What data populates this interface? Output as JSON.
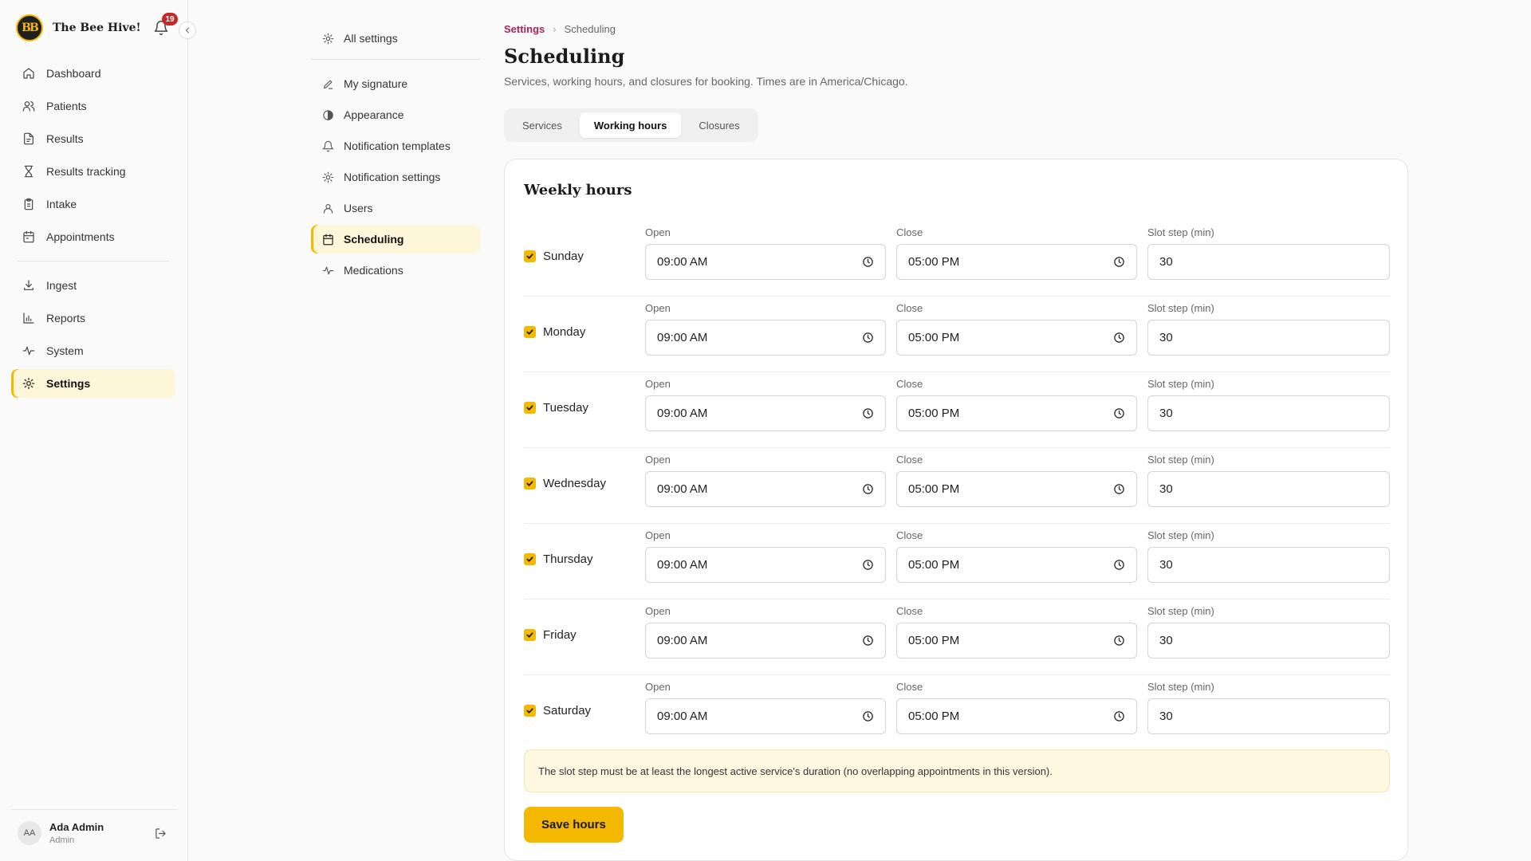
{
  "app": {
    "name": "The Bee Hive!",
    "logo_text": "BB",
    "notification_count": "19"
  },
  "sidebar": {
    "primary": [
      {
        "label": "Dashboard",
        "icon": "home-icon"
      },
      {
        "label": "Patients",
        "icon": "users-icon"
      },
      {
        "label": "Results",
        "icon": "file-icon"
      },
      {
        "label": "Results tracking",
        "icon": "hourglass-icon"
      },
      {
        "label": "Intake",
        "icon": "clipboard-icon"
      },
      {
        "label": "Appointments",
        "icon": "calendar-icon"
      }
    ],
    "secondary": [
      {
        "label": "Ingest",
        "icon": "download-icon"
      },
      {
        "label": "Reports",
        "icon": "bar-chart-icon"
      },
      {
        "label": "System",
        "icon": "activity-icon"
      },
      {
        "label": "Settings",
        "icon": "gear-icon",
        "active": true
      }
    ],
    "user": {
      "initials": "AA",
      "name": "Ada Admin",
      "role": "Admin"
    }
  },
  "settings_nav": {
    "all_settings": "All settings",
    "items": [
      {
        "label": "My signature",
        "icon": "pen-icon"
      },
      {
        "label": "Appearance",
        "icon": "palette-icon"
      },
      {
        "label": "Notification templates",
        "icon": "bell-icon"
      },
      {
        "label": "Notification settings",
        "icon": "gear-icon"
      },
      {
        "label": "Users",
        "icon": "user-icon"
      },
      {
        "label": "Scheduling",
        "icon": "calendar-icon",
        "active": true
      },
      {
        "label": "Medications",
        "icon": "activity-icon"
      }
    ]
  },
  "breadcrumb": {
    "root": "Settings",
    "current": "Scheduling"
  },
  "page": {
    "title": "Scheduling",
    "subtitle": "Services, working hours, and closures for booking. Times are in America/Chicago."
  },
  "tabs": [
    {
      "label": "Services"
    },
    {
      "label": "Working hours",
      "active": true
    },
    {
      "label": "Closures"
    }
  ],
  "weekly": {
    "title": "Weekly hours",
    "labels": {
      "open": "Open",
      "close": "Close",
      "slot": "Slot step (min)"
    },
    "days": [
      {
        "name": "Sunday",
        "enabled": true,
        "open": "09:00 AM",
        "close": "05:00 PM",
        "slot": "30"
      },
      {
        "name": "Monday",
        "enabled": true,
        "open": "09:00 AM",
        "close": "05:00 PM",
        "slot": "30"
      },
      {
        "name": "Tuesday",
        "enabled": true,
        "open": "09:00 AM",
        "close": "05:00 PM",
        "slot": "30"
      },
      {
        "name": "Wednesday",
        "enabled": true,
        "open": "09:00 AM",
        "close": "05:00 PM",
        "slot": "30"
      },
      {
        "name": "Thursday",
        "enabled": true,
        "open": "09:00 AM",
        "close": "05:00 PM",
        "slot": "30"
      },
      {
        "name": "Friday",
        "enabled": true,
        "open": "09:00 AM",
        "close": "05:00 PM",
        "slot": "30"
      },
      {
        "name": "Saturday",
        "enabled": true,
        "open": "09:00 AM",
        "close": "05:00 PM",
        "slot": "30"
      }
    ],
    "note": "The slot step must be at least the longest active service's duration (no overlapping appointments in this version).",
    "save_label": "Save hours"
  },
  "colors": {
    "accent": "#f5b800",
    "active_bg": "#fef6d8",
    "breadcrumb_link": "#b0215a",
    "badge": "#c62828"
  }
}
